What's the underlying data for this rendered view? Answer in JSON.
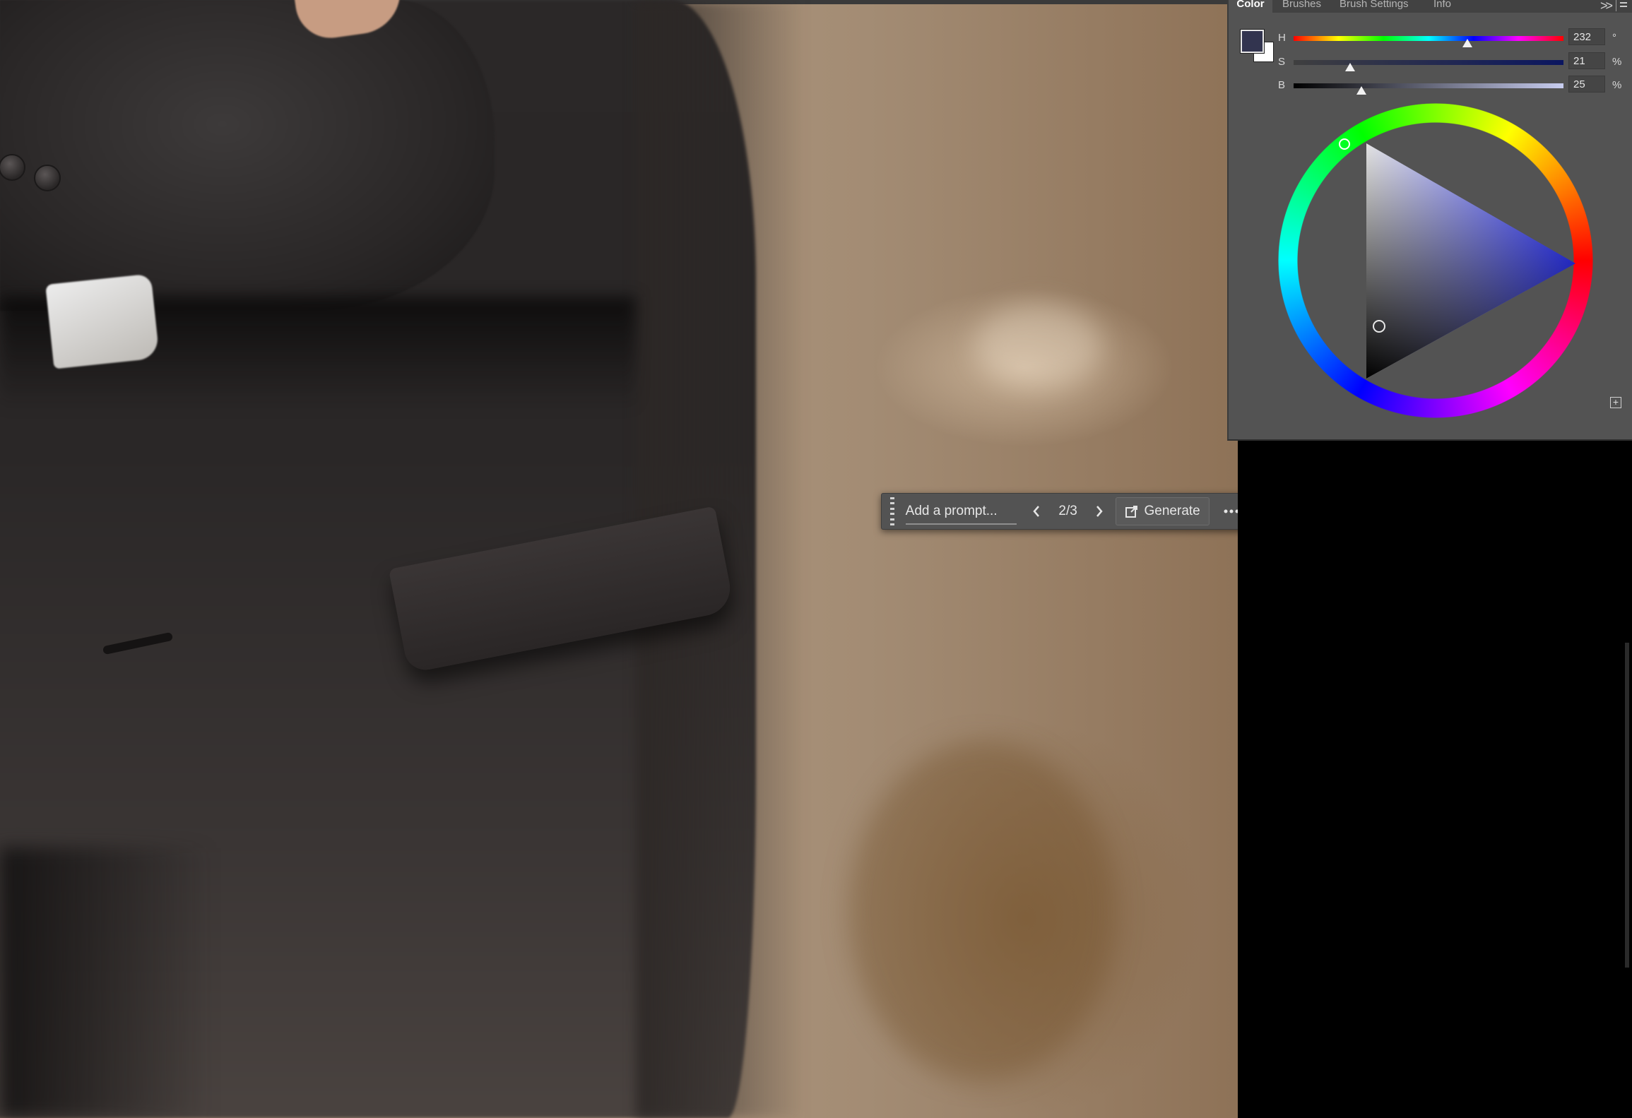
{
  "panel": {
    "tabs": [
      "Color",
      "Brushes",
      "Brush Settings",
      "Info"
    ],
    "active_tab": "Color",
    "overflow_glyph": ">>",
    "foreground_color": "#32344f",
    "background_color": "#ffffff",
    "sliders": [
      {
        "label": "H",
        "value": "232",
        "unit": "°",
        "level": 0.644
      },
      {
        "label": "S",
        "value": "21",
        "unit": "%",
        "level": 0.21
      },
      {
        "label": "B",
        "value": "25",
        "unit": "%",
        "level": 0.25
      }
    ],
    "wheel_hue": 232,
    "add_glyph": "+"
  },
  "taskbar": {
    "prompt_placeholder": "Add a prompt...",
    "counter": "2/3",
    "generate_label": "Generate",
    "prev_icon": "chevron-left-icon",
    "next_icon": "chevron-right-icon",
    "more_icon": "ellipsis-icon"
  }
}
